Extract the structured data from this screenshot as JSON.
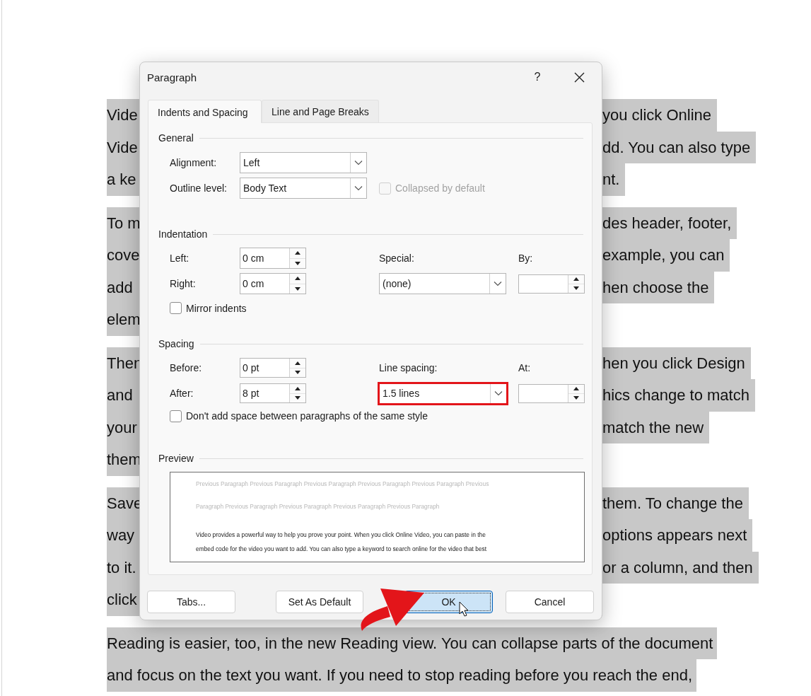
{
  "document": {
    "paragraphs": [
      {
        "lines": [
          {
            "kind": "split",
            "left": "Vide",
            "right": "you click Online"
          },
          {
            "kind": "split",
            "left": "Vide",
            "right": "dd. You can also type"
          },
          {
            "kind": "split",
            "left": "a ke",
            "right": "nt."
          }
        ]
      },
      {
        "lines": [
          {
            "kind": "split",
            "left": "To m",
            "right": "des header, footer,"
          },
          {
            "kind": "split",
            "left": "cove",
            "right": "example, you can"
          },
          {
            "kind": "split",
            "left": "add",
            "right": "hen choose the"
          },
          {
            "kind": "split",
            "left": "elem"
          }
        ]
      },
      {
        "lines": [
          {
            "kind": "split",
            "left": "Then",
            "right": "hen you click Design"
          },
          {
            "kind": "split",
            "left": "and",
            "right": "hics change to match"
          },
          {
            "kind": "split",
            "left": "your",
            "right": "match the new"
          },
          {
            "kind": "split",
            "left": "them"
          }
        ]
      },
      {
        "lines": [
          {
            "kind": "split",
            "left": "Save",
            "right": "them. To change the"
          },
          {
            "kind": "split",
            "left": "way",
            "right": "options appears next"
          },
          {
            "kind": "split",
            "left": "to it.",
            "right": "or a column, and then"
          },
          {
            "kind": "split",
            "left": "click"
          }
        ]
      },
      {
        "lines": [
          {
            "kind": "full",
            "text": "Reading is easier, too, in the new Reading view. You can collapse parts of the document"
          },
          {
            "kind": "full",
            "text": "and focus on the text you want. If you need to stop reading before you reach the end,"
          }
        ]
      }
    ]
  },
  "dialog": {
    "title": "Paragraph",
    "help": "?",
    "tabs": [
      {
        "label": "Indents and Spacing",
        "selected": true
      },
      {
        "label": "Line and Page Breaks",
        "selected": false
      }
    ],
    "general": {
      "heading": "General",
      "alignment": {
        "label": "Alignment:",
        "value": "Left"
      },
      "outline_level": {
        "label": "Outline level:",
        "value": "Body Text"
      },
      "collapsed": {
        "label": "Collapsed by default",
        "checked": false,
        "disabled": true
      }
    },
    "indentation": {
      "heading": "Indentation",
      "left": {
        "label": "Left:",
        "value": "0 cm"
      },
      "right": {
        "label": "Right:",
        "value": "0 cm"
      },
      "special": {
        "label": "Special:",
        "value": "(none)"
      },
      "by": {
        "label": "By:"
      },
      "mirror": {
        "label": "Mirror indents",
        "checked": false
      }
    },
    "spacing": {
      "heading": "Spacing",
      "before": {
        "label": "Before:",
        "value": "0 pt"
      },
      "after": {
        "label": "After:",
        "value": "8 pt"
      },
      "line_spacing": {
        "label": "Line spacing:",
        "value": "1.5 lines",
        "highlighted": true
      },
      "at": {
        "label": "At:"
      },
      "dont_add": {
        "label": "Don't add space between paragraphs of the same style",
        "checked": false
      }
    },
    "preview": {
      "heading": "Preview",
      "previous_lines": [
        "Previous Paragraph Previous Paragraph Previous Paragraph Previous Paragraph Previous Paragraph Previous",
        "Paragraph Previous Paragraph Previous Paragraph Previous Paragraph Previous Paragraph"
      ],
      "sample_lines": [
        "Video provides a powerful way to help you prove your point. When you click Online Video, you can paste in the",
        "embed code for the video you want to add. You can also type a keyword to search online for the video that best"
      ]
    },
    "buttons": [
      {
        "label": "Tabs...",
        "focused": false
      },
      {
        "label": "Set As Default",
        "focused": false
      },
      {
        "label": "OK",
        "focused": true
      },
      {
        "label": "Cancel",
        "focused": false
      }
    ]
  }
}
